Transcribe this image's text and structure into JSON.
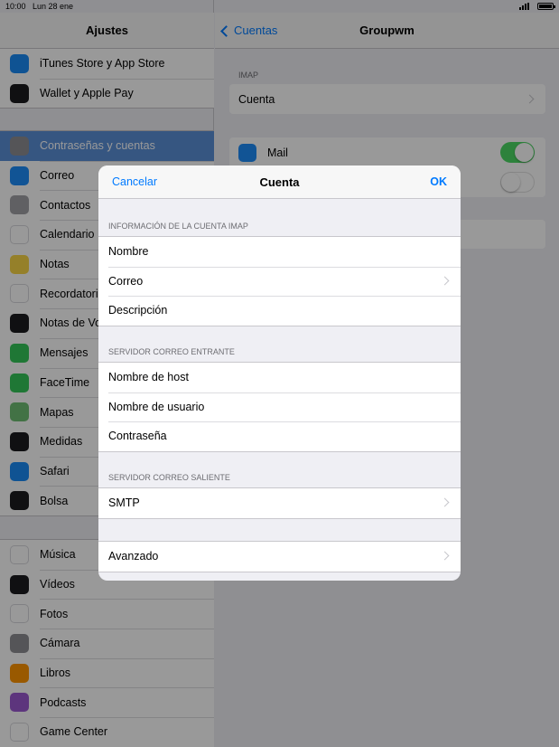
{
  "status": {
    "time": "10:00",
    "date": "Lun 28 ene"
  },
  "master": {
    "title": "Ajustes",
    "group1": [
      {
        "label": "iTunes Store y App Store",
        "icon": "app-store-icon",
        "color": "#1a8af5"
      },
      {
        "label": "Wallet y Apple Pay",
        "icon": "wallet-icon",
        "color": "#1c1c1e"
      }
    ],
    "group2": [
      {
        "label": "Contraseñas y cuentas",
        "icon": "key-icon",
        "color": "#8e8e93",
        "active": true
      },
      {
        "label": "Correo",
        "icon": "mail-icon",
        "color": "#1d8cf8"
      },
      {
        "label": "Contactos",
        "icon": "contacts-icon",
        "color": "#a0a0a5"
      },
      {
        "label": "Calendario",
        "icon": "calendar-icon",
        "color": "#ffffff"
      },
      {
        "label": "Notas",
        "icon": "notes-icon",
        "color": "#f8d547"
      },
      {
        "label": "Recordatorios",
        "icon": "reminders-icon",
        "color": "#ffffff"
      },
      {
        "label": "Notas de Voz",
        "icon": "voice-memos-icon",
        "color": "#1c1c1e"
      },
      {
        "label": "Mensajes",
        "icon": "messages-icon",
        "color": "#34c759"
      },
      {
        "label": "FaceTime",
        "icon": "facetime-icon",
        "color": "#34c759"
      },
      {
        "label": "Mapas",
        "icon": "maps-icon",
        "color": "#6fbf73"
      },
      {
        "label": "Medidas",
        "icon": "measure-icon",
        "color": "#1c1c1e"
      },
      {
        "label": "Safari",
        "icon": "safari-icon",
        "color": "#1a8af5"
      },
      {
        "label": "Bolsa",
        "icon": "stocks-icon",
        "color": "#1c1c1e"
      }
    ],
    "group3": [
      {
        "label": "Música",
        "icon": "music-icon",
        "color": "#ffffff"
      },
      {
        "label": "Vídeos",
        "icon": "videos-icon",
        "color": "#1c1c1e"
      },
      {
        "label": "Fotos",
        "icon": "photos-icon",
        "color": "#ffffff"
      },
      {
        "label": "Cámara",
        "icon": "camera-icon",
        "color": "#8e8e93"
      },
      {
        "label": "Libros",
        "icon": "books-icon",
        "color": "#ff9500"
      },
      {
        "label": "Podcasts",
        "icon": "podcasts-icon",
        "color": "#9b59d0"
      },
      {
        "label": "Game Center",
        "icon": "game-center-icon",
        "color": "#ffffff"
      }
    ]
  },
  "detail": {
    "back": "Cuentas",
    "title": "Groupwm",
    "imap_label": "IMAP",
    "account_row": "Cuenta",
    "mail_row": "Mail"
  },
  "modal": {
    "cancel": "Cancelar",
    "title": "Cuenta",
    "ok": "OK",
    "section1": "INFORMACIÓN DE LA CUENTA IMAP",
    "section1_rows": [
      "Nombre",
      "Correo",
      "Descripción"
    ],
    "section2": "SERVIDOR CORREO ENTRANTE",
    "section2_rows": [
      "Nombre de host",
      "Nombre de usuario",
      "Contraseña"
    ],
    "section3": "SERVIDOR CORREO SALIENTE",
    "smtp": "SMTP",
    "advanced": "Avanzado"
  }
}
